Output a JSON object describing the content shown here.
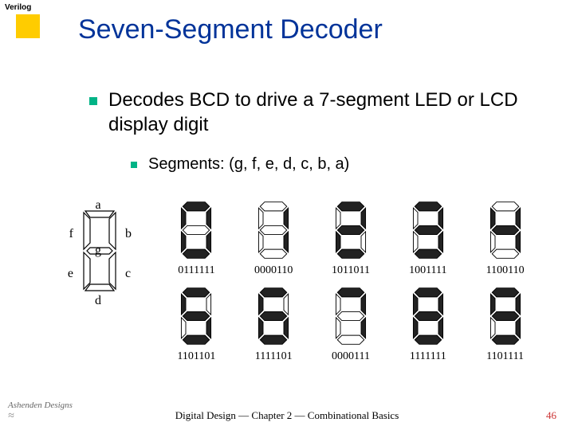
{
  "header": "Verilog",
  "title": "Seven-Segment Decoder",
  "main_bullet": "Decodes BCD to drive a 7-segment LED or LCD display digit",
  "sub_bullet": "Segments: (g, f, e, d, c, b, a)",
  "segment_labels": {
    "a": "a",
    "b": "b",
    "c": "c",
    "d": "d",
    "e": "e",
    "f": "f",
    "g": "g"
  },
  "digits": [
    {
      "value": 0,
      "code": "0111111",
      "segs": "abcdef"
    },
    {
      "value": 1,
      "code": "0000110",
      "segs": "bc"
    },
    {
      "value": 2,
      "code": "1011011",
      "segs": "abdeg"
    },
    {
      "value": 3,
      "code": "1001111",
      "segs": "abcdg"
    },
    {
      "value": 4,
      "code": "1100110",
      "segs": "bcfg"
    },
    {
      "value": 5,
      "code": "1101101",
      "segs": "acdfg"
    },
    {
      "value": 6,
      "code": "1111101",
      "segs": "acdefg"
    },
    {
      "value": 7,
      "code": "0000111",
      "segs": "abc"
    },
    {
      "value": 8,
      "code": "1111111",
      "segs": "abcdefg"
    },
    {
      "value": 9,
      "code": "1101111",
      "segs": "abcdfg"
    }
  ],
  "footer": "Digital Design — Chapter 2 — Combinational Basics",
  "page": "46",
  "logo": "Ashenden Designs"
}
